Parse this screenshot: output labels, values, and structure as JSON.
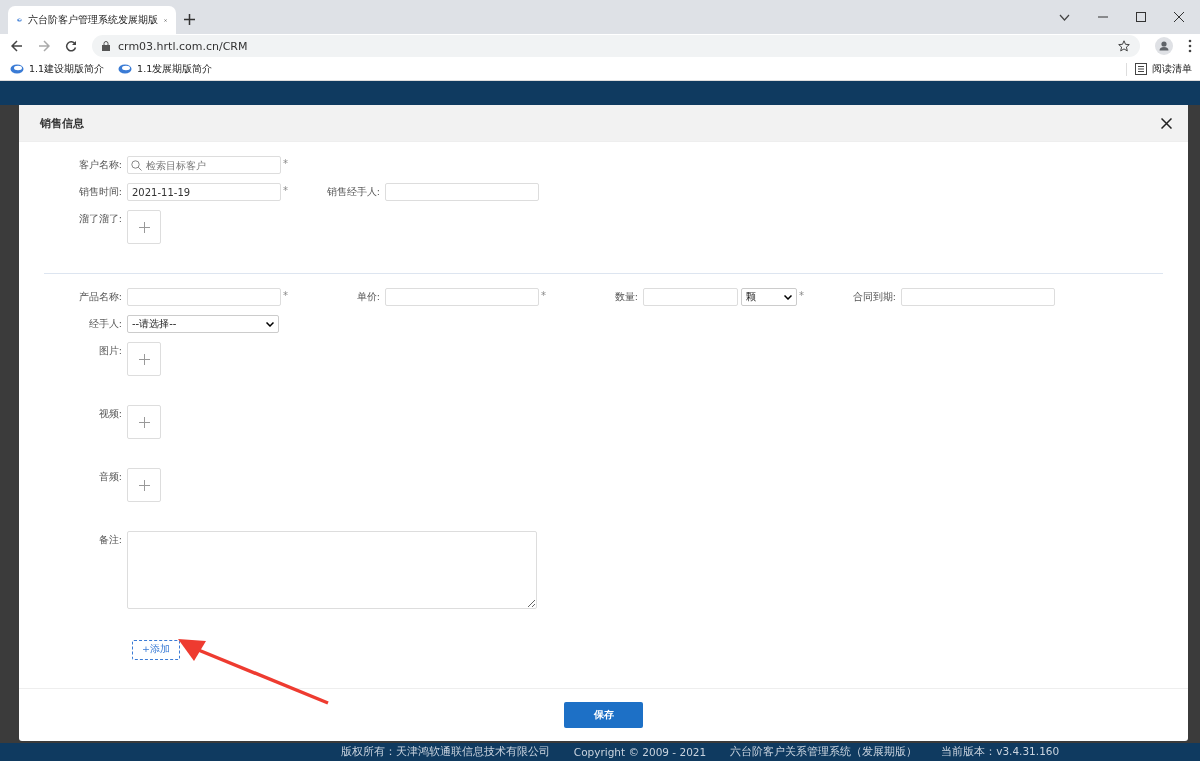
{
  "browser": {
    "tab_title": "六台阶客户管理系统发展期版",
    "url": "crm03.hrtl.com.cn/CRM",
    "bookmarks": [
      "1.1建设期版简介",
      "1.1发展期版简介"
    ],
    "reading_list": "阅读清单"
  },
  "modal": {
    "title": "销售信息",
    "section_1": [
      [
        {
          "kind": "search",
          "label": "客户名称:",
          "placeholder": "检索目标客户",
          "mark": "*"
        }
      ],
      [
        {
          "kind": "text",
          "label": "销售时间:",
          "value": "2021-11-19",
          "mark": "*"
        },
        {
          "kind": "text",
          "label": "销售经手人:"
        }
      ],
      [
        {
          "kind": "upload",
          "label": "溜了溜了:"
        }
      ]
    ],
    "section_2": [
      [
        {
          "kind": "text",
          "label": "产品名称:",
          "mark": "*"
        },
        {
          "kind": "text",
          "label": "单价:",
          "mark": "*"
        },
        {
          "kind": "quantity",
          "label": "数量:",
          "unit": "颗",
          "mark": "*"
        },
        {
          "kind": "text",
          "label": "合同到期:"
        }
      ],
      [
        {
          "kind": "select",
          "label": "经手人:",
          "value": "--请选择--"
        }
      ],
      [
        {
          "kind": "upload",
          "label": "图片:"
        }
      ],
      [
        {
          "kind": "upload",
          "label": "视频:"
        }
      ],
      [
        {
          "kind": "upload",
          "label": "音频:"
        }
      ],
      [
        {
          "kind": "textarea",
          "label": "备注:"
        }
      ]
    ],
    "add_button": "+添加",
    "save_button": "保存"
  },
  "footer": [
    "版权所有：天津鸿软通联信息技术有限公司",
    "Copyright © 2009 - 2021",
    "六台阶客户关系管理系统（发展期版）",
    "当前版本：v3.4.31.160"
  ]
}
